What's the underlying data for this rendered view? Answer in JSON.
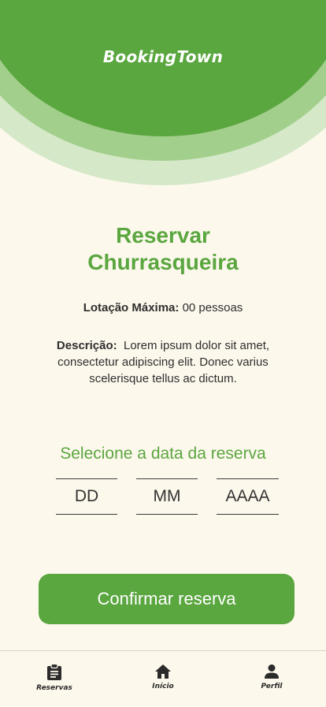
{
  "header": {
    "brand": "BookingTown"
  },
  "colors": {
    "accent": "#5aa63f",
    "background": "#fdf8ec",
    "text": "#2e2e2e"
  },
  "page": {
    "title_line1": "Reservar",
    "title_line2": "Churrasqueira",
    "capacity_label": "Lotação Máxima:",
    "capacity_value": "00 pessoas",
    "description_label": "Descrição:",
    "description_text": "Lorem ipsum dolor sit amet, consectetur adipiscing elit. Donec varius scelerisque tellus ac dictum."
  },
  "date": {
    "label": "Selecione a data da reserva",
    "day_placeholder": "DD",
    "month_placeholder": "MM",
    "year_placeholder": "AAAA"
  },
  "actions": {
    "confirm_label": "Confirmar reserva"
  },
  "nav": {
    "items": [
      {
        "label": "Reservas",
        "icon": "clipboard-icon"
      },
      {
        "label": "Início",
        "icon": "home-icon"
      },
      {
        "label": "Perfil",
        "icon": "person-icon"
      }
    ]
  }
}
